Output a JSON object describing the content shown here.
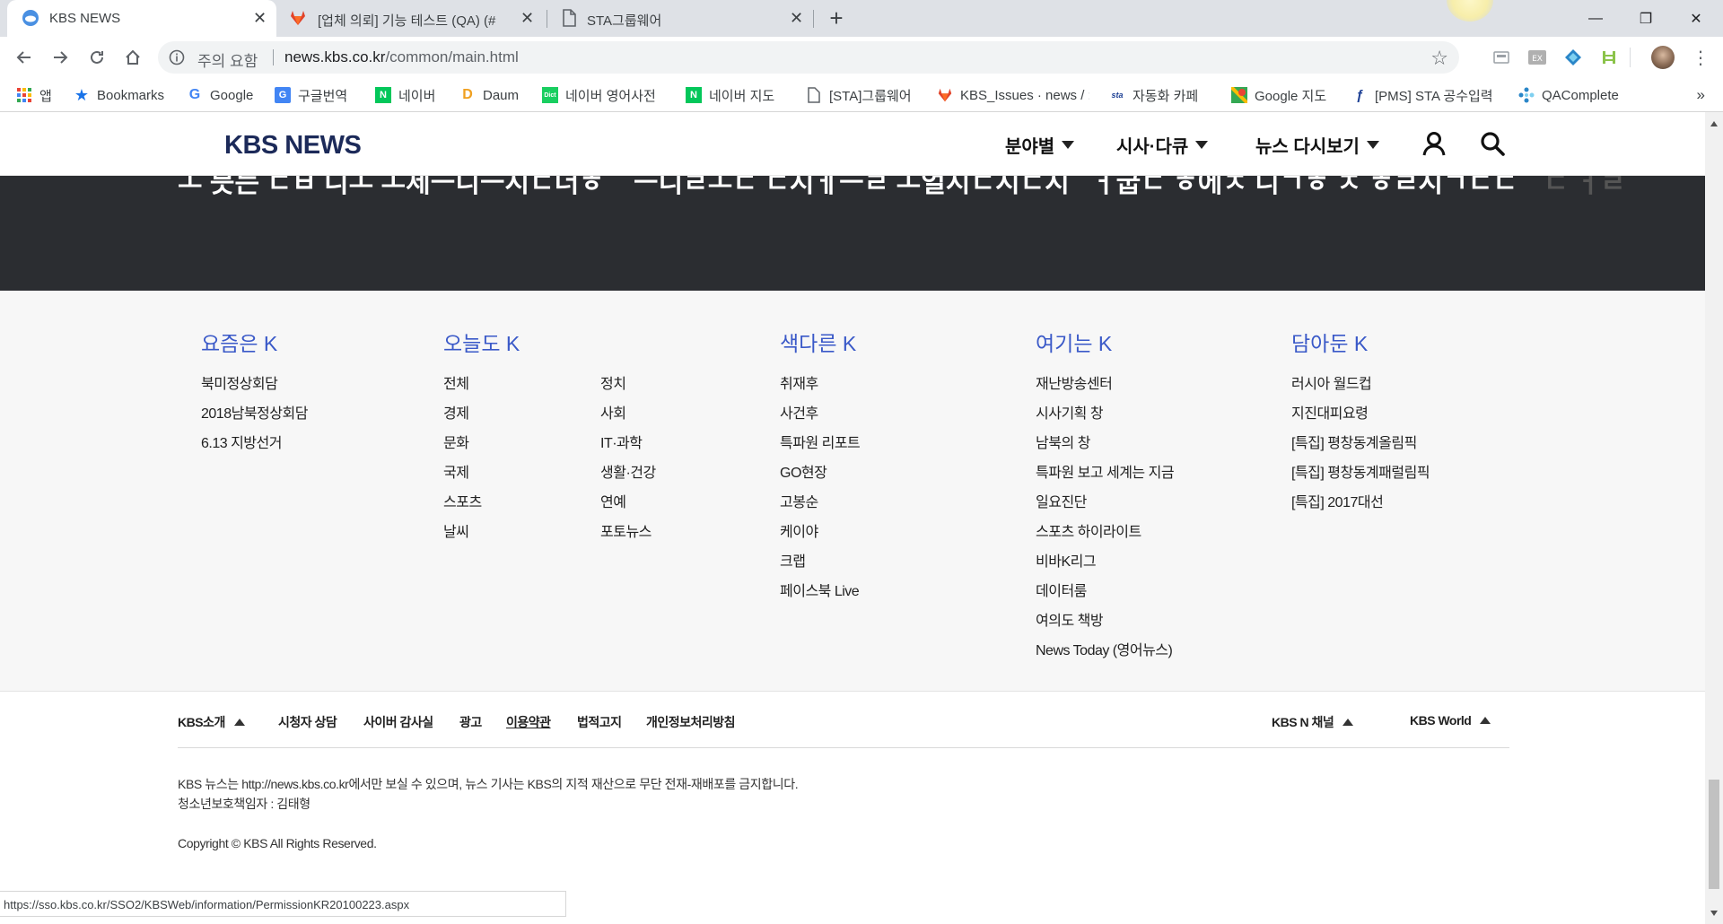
{
  "browser": {
    "tabs": [
      {
        "title": "KBS NEWS",
        "active": true,
        "icon": "kbs-favicon"
      },
      {
        "title": "[업체 의뢰] 기능 테스트 (QA) (#",
        "active": false,
        "icon": "gitlab-icon"
      },
      {
        "title": "STA그룹웨어",
        "active": false,
        "icon": "page-icon"
      }
    ],
    "new_tab": "+",
    "window_controls": {
      "minimize": "—",
      "restore": "❐",
      "close": "✕"
    },
    "address": {
      "security_label": "주의 요함",
      "url_host": "news.kbs.co.kr",
      "url_path": "/common/main.html"
    },
    "bookmarks": [
      {
        "label": "앱",
        "icon": "apps-grid-icon"
      },
      {
        "label": "Bookmarks",
        "icon": "star-icon"
      },
      {
        "label": "Google",
        "icon": "google-icon"
      },
      {
        "label": "구글번역",
        "icon": "translate-icon"
      },
      {
        "label": "네이버",
        "icon": "naver-icon"
      },
      {
        "label": "Daum",
        "icon": "daum-icon"
      },
      {
        "label": "네이버 영어사전",
        "icon": "dict-icon"
      },
      {
        "label": "네이버 지도",
        "icon": "naver-icon"
      },
      {
        "label": "[STA]그룹웨어",
        "icon": "page-icon"
      },
      {
        "label": "KBS_Issues · news / :",
        "icon": "gitlab-icon"
      },
      {
        "label": "자동화 카페",
        "icon": "sta-icon"
      },
      {
        "label": "Google 지도",
        "icon": "maps-icon"
      },
      {
        "label": "[PMS] STA 공수입력",
        "icon": "pms-icon"
      },
      {
        "label": "QAComplete",
        "icon": "qacomplete-icon"
      }
    ],
    "bookmarks_more": "»",
    "status_url": "https://sso.kbs.co.kr/SSO2/KBSWeb/information/PermissionKR20100223.aspx"
  },
  "header": {
    "logo": "KBS NEWS",
    "menu": [
      {
        "label": "분야별"
      },
      {
        "label": "시사·다큐"
      },
      {
        "label": "뉴스 다시보기"
      }
    ]
  },
  "band": {
    "snippets": [
      "ㅗ 믓는 ㄷㅂ 니ㅗ ㅗ세ㅡ니ㅡ시ㄷ더ㅎ",
      "ㅡ니ㄹㅗㄷ ㄷ시ㅔㅡㄹ  ㅗ얼시ㄷ시ㄷ시",
      "ㅓ굽ㄷ ㅎ에ㅈ 니ㄱㅎ  ㅈ ㅎㄹ시ㄱㄷㄷ",
      "ㄷ ㅓㄹ"
    ]
  },
  "sitemap": {
    "columns": [
      {
        "title": "요즘은 K",
        "links": [
          "북미정상회담",
          "2018남북정상회담",
          "6.13 지방선거"
        ]
      },
      {
        "title": "오늘도 K",
        "links": [
          "전체",
          "경제",
          "문화",
          "국제",
          "스포츠",
          "날씨"
        ],
        "links2": [
          "정치",
          "사회",
          "IT·과학",
          "생활·건강",
          "연예",
          "포토뉴스"
        ]
      },
      {
        "title": "색다른 K",
        "links": [
          "취재후",
          "사건후",
          "특파원 리포트",
          "GO현장",
          "고봉순",
          "케이야",
          "크랩",
          "페이스북 Live"
        ]
      },
      {
        "title": "여기는 K",
        "links": [
          "재난방송센터",
          "시사기획 창",
          "남북의 창",
          "특파원 보고 세계는 지금",
          "일요진단",
          "스포츠 하이라이트",
          "비바K리그",
          "데이터룸",
          "여의도 책방",
          "News Today (영어뉴스)"
        ]
      },
      {
        "title": "담아둔 K",
        "links": [
          "러시아 월드컵",
          "지진대피요령",
          "[특집] 평창동계올림픽",
          "[특집] 평창동계패럴림픽",
          "[특집] 2017대선"
        ]
      }
    ]
  },
  "footer": {
    "links": [
      "KBS소개",
      "시청자 상담",
      "사이버 감사실",
      "광고",
      "이용약관",
      "법적고지",
      "개인정보처리방침"
    ],
    "right_links": [
      "KBS N 채널",
      "KBS World"
    ],
    "notice1": "KBS 뉴스는 http://news.kbs.co.kr에서만 보실 수 있으며, 뉴스 기사는 KBS의 지적 재산으로 무단 전재-재배포를 금지합니다.",
    "notice2": "청소년보호책임자 : 김태형",
    "copyright": "Copyright © KBS All Rights Reserved."
  }
}
